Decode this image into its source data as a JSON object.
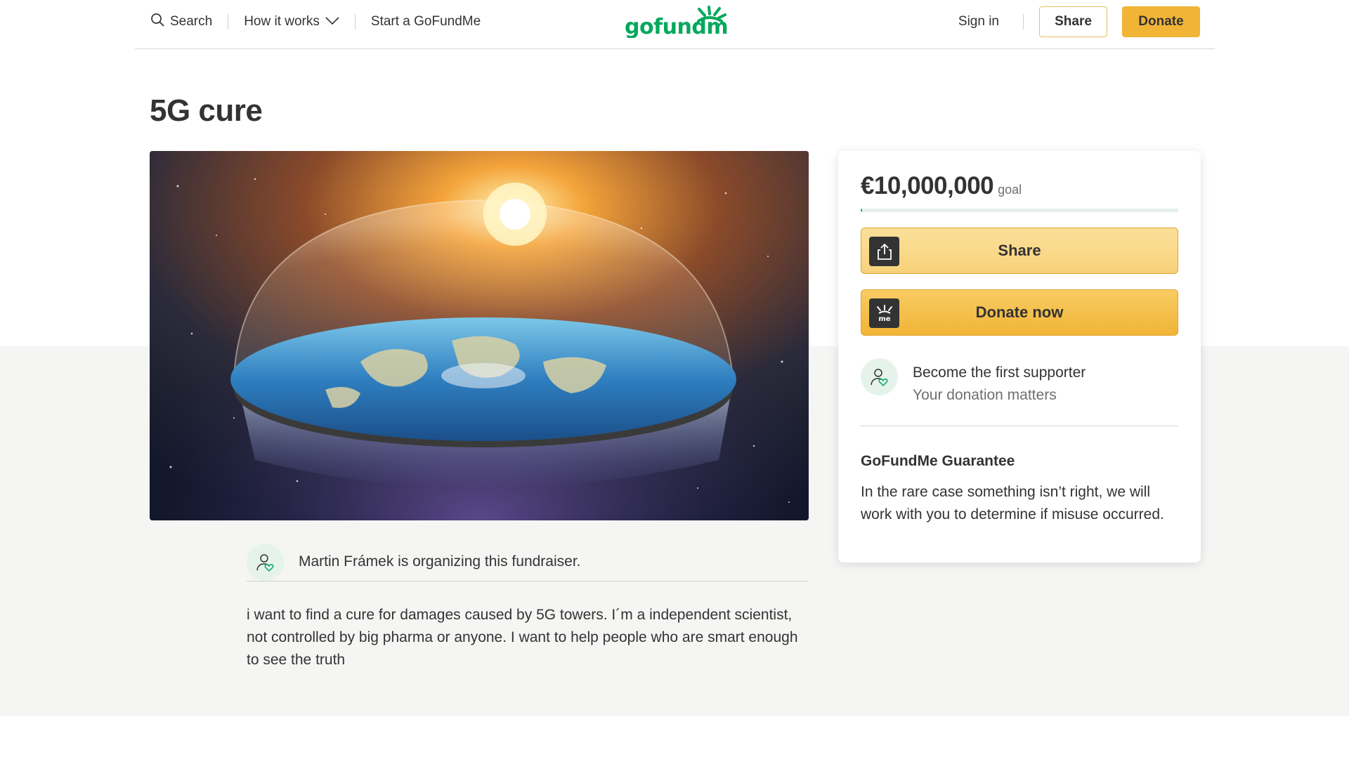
{
  "header": {
    "search_label": "Search",
    "how_it_works_label": "How it works",
    "start_label": "Start a GoFundMe",
    "logo_text": "gofundme",
    "signin_label": "Sign in",
    "share_label": "Share",
    "donate_label": "Donate"
  },
  "campaign": {
    "title": "5G cure",
    "organizer_text": "Martin Frámek is organizing this fundraiser.",
    "story": "i want to find a cure for damages caused by 5G towers. I´m a independent scientist, not controlled by big pharma or anyone. I want to help people who are smart enough to see the truth"
  },
  "card": {
    "amount": "€10,000,000",
    "goal_label": "goal",
    "progress_fraction": 0.005,
    "share_label": "Share",
    "donate_label": "Donate now",
    "supporter_title": "Become the first supporter",
    "supporter_subtitle": "Your donation matters",
    "guarantee_title": "GoFundMe Guarantee",
    "guarantee_text": "In the rare case something isn’t right, we will work with you to determine if misuse occurred."
  },
  "icons": {
    "search": "search-icon",
    "chevron": "chevron-down-icon",
    "share": "share-upload-icon",
    "donate": "gofundme-me-icon",
    "supporter": "person-heart-icon"
  },
  "colors": {
    "brand_green": "#02a95c",
    "donate_yellow": "#f1b436",
    "text": "#333333"
  }
}
